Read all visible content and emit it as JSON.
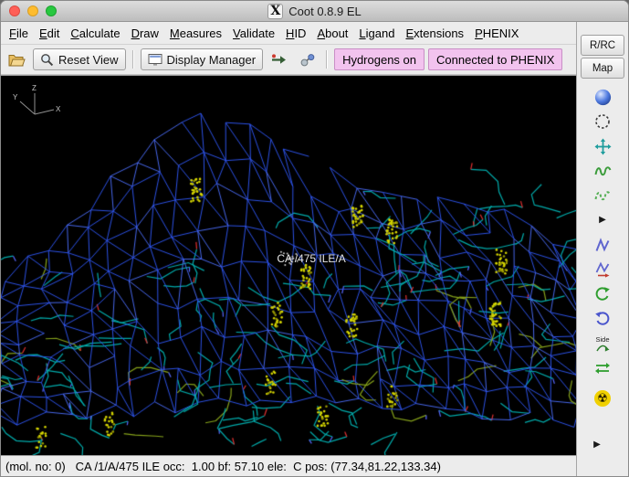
{
  "window": {
    "title": "Coot 0.8.9 EL",
    "x11_icon_glyph": "X"
  },
  "menubar": {
    "items": [
      {
        "label": "File"
      },
      {
        "label": "Edit"
      },
      {
        "label": "Calculate"
      },
      {
        "label": "Draw"
      },
      {
        "label": "Measures"
      },
      {
        "label": "Validate"
      },
      {
        "label": "HID"
      },
      {
        "label": "About"
      },
      {
        "label": "Ligand"
      },
      {
        "label": "Extensions"
      },
      {
        "label": "PHENIX"
      }
    ]
  },
  "toolbar": {
    "reset_view_label": "Reset View",
    "display_manager_label": "Display Manager",
    "chips": [
      {
        "label": "Hydrogens on",
        "bg": "#f2c3ee"
      },
      {
        "label": "Connected to PHENIX",
        "bg": "#f2c3ee"
      }
    ]
  },
  "right_panel": {
    "rrc_button_label": "R/RC",
    "map_button_label": "Map",
    "side_flip_label": "Side"
  },
  "viewport": {
    "atom_label": "CA /475 ILE/A",
    "axes": {
      "x": "X",
      "y": "Y",
      "z": "Z"
    }
  },
  "statusbar": {
    "text": "(mol. no: 0)   CA /1/A/475 ILE occ:  1.00 bf: 57.10 ele:  C pos: (77.34,81.22,133.34)"
  },
  "glyphs": {
    "radiation": "☢",
    "expander": "▶"
  },
  "icons": {
    "titlebar": [
      "close",
      "minimize",
      "maximize",
      "x11-logo"
    ],
    "toolbar": [
      "folder-open-icon",
      "magnifier-icon",
      "monitor-icon",
      "goto-arrow-icon",
      "molecule-icon"
    ],
    "right_strip": [
      "sphere-icon",
      "dashed-circle-icon",
      "move-cross-icon",
      "coil-icon",
      "dashed-coil-icon",
      "expander-icon",
      "torsion-zigzag-icon",
      "torsion-zigzag-arrow-icon",
      "circular-arrow-green-icon",
      "circular-arrow-blue-icon",
      "side-chain-flip-icon",
      "exchange-arrows-icon",
      "radiation-icon",
      "bottom-expander-icon"
    ]
  },
  "colors": {
    "chip_bg": "#f2c3ee",
    "chip_border": "#c98fc6",
    "mesh_blue": "#2e55f0",
    "mesh_blue_light": "#4a6cf5",
    "stick_teal": "#00aaaa",
    "stick_green": "#86a21a",
    "dots_yellow": "#d6d600",
    "oxygen_red": "#e03030",
    "nitrogen_blue": "#5868ff",
    "label_color": "#e6e6e6"
  }
}
